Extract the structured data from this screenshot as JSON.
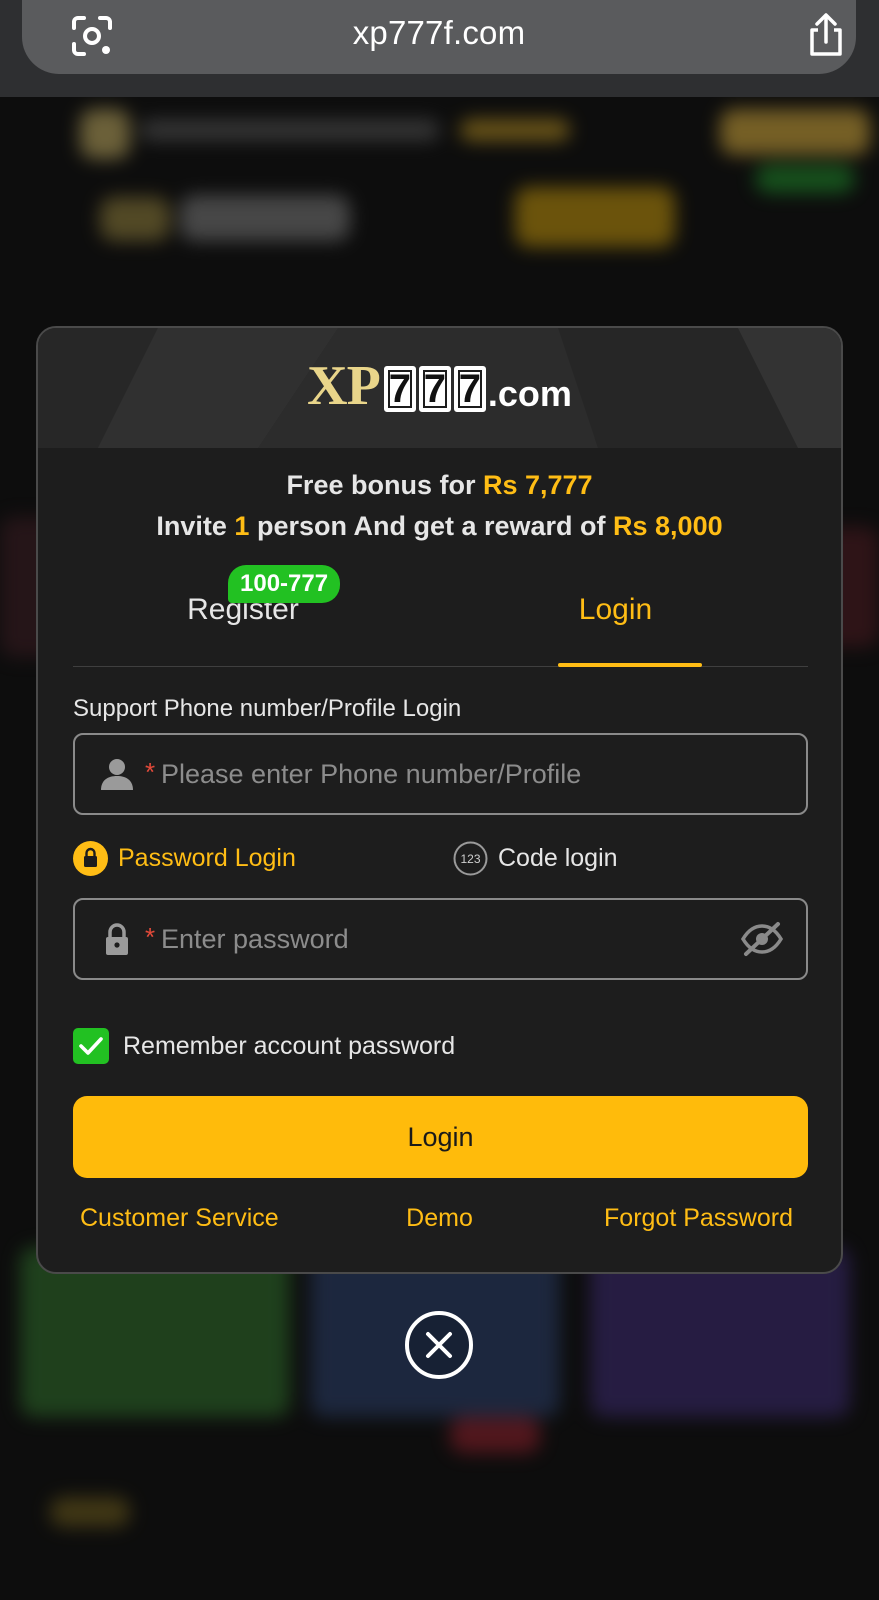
{
  "browser": {
    "url": "xp777f.com"
  },
  "icons": {
    "lens": "google-lens-icon",
    "share": "share-icon",
    "user": "user-icon",
    "lock": "lock-icon",
    "code": "code-123-icon",
    "eye": "eye-hidden-icon",
    "check": "check-icon",
    "close": "close-icon"
  },
  "modal": {
    "logo": {
      "brand": "XP",
      "digits": [
        "7",
        "7",
        "7"
      ],
      "suffix": ".com"
    },
    "promo": {
      "line1_prefix": "Free bonus for ",
      "line1_amount": "Rs 7,777",
      "line2_prefix": "Invite ",
      "line2_count": "1",
      "line2_middle": " person And get a reward of ",
      "line2_amount": "Rs 8,000"
    },
    "tabs": {
      "register_label": "Register",
      "register_badge": "100-777",
      "login_label": "Login",
      "active": "Login"
    },
    "support_label": "Support Phone number/Profile Login",
    "phone_input": {
      "required_mark": "*",
      "placeholder": "Please enter Phone number/Profile",
      "value": ""
    },
    "methods": {
      "password_label": "Password Login",
      "code_label": "Code login",
      "active": "Password Login"
    },
    "password_input": {
      "required_mark": "*",
      "placeholder": "Enter password",
      "value": ""
    },
    "remember": {
      "label": "Remember account password",
      "checked": true
    },
    "login_button_label": "Login",
    "footer_links": {
      "customer_service": "Customer Service",
      "demo": "Demo",
      "forgot_password": "Forgot Password"
    }
  },
  "colors": {
    "accent": "#ffbd15",
    "success": "#22c122",
    "modal_bg": "#1d1d1d",
    "required": "#e34a3a"
  }
}
